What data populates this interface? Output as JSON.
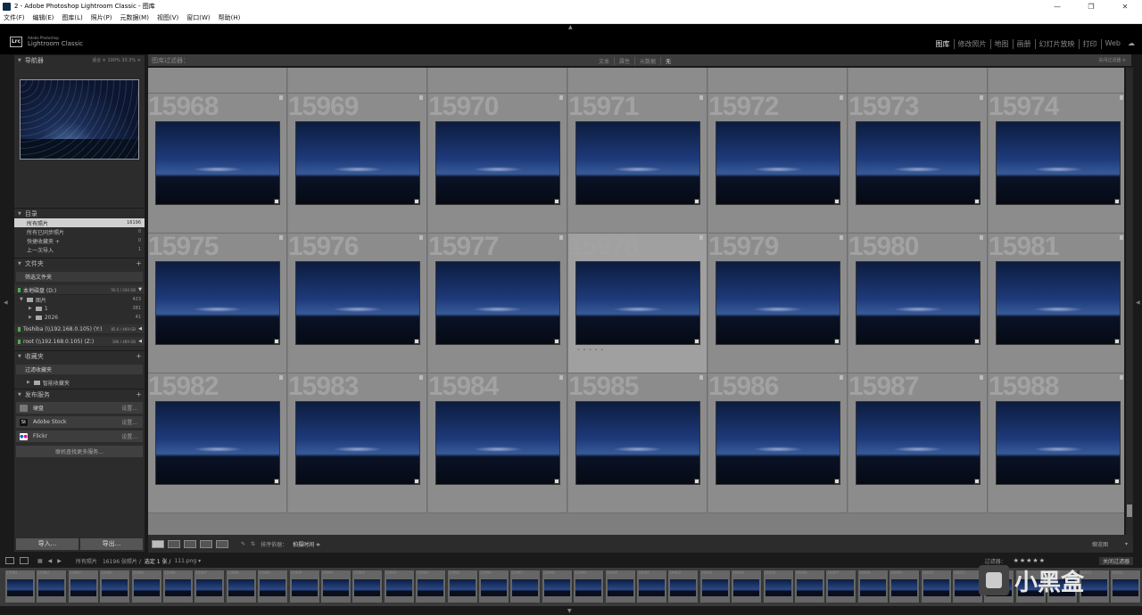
{
  "window": {
    "title": "2 - Adobe Photoshop Lightroom Classic - 图库",
    "controls": [
      "—",
      "❐",
      "✕"
    ]
  },
  "menu": [
    "文件(F)",
    "编辑(E)",
    "图库(L)",
    "照片(P)",
    "元数据(M)",
    "视图(V)",
    "窗口(W)",
    "帮助(H)"
  ],
  "brand": {
    "logo": "Lrc",
    "line1": "Adobe Photoshop",
    "line2": "Lightroom Classic"
  },
  "modules": [
    "图库",
    "修改照片",
    "地图",
    "画册",
    "幻灯片放映",
    "打印",
    "Web"
  ],
  "left": {
    "navigator": {
      "title": "导航器",
      "opts": "适合 ≑  100%  33.3% ≑"
    },
    "catalog": {
      "title": "目录",
      "items": [
        {
          "label": "所有照片",
          "count": "16196"
        },
        {
          "label": "所有已同步照片",
          "count": "0"
        },
        {
          "label": "快捷收藏夹 +",
          "count": "0"
        },
        {
          "label": "上一次导入",
          "count": "1"
        }
      ]
    },
    "folders": {
      "title": "文件夹",
      "filter": "筛选文件夹",
      "vol1": {
        "label": "本地磁盘 (D:)",
        "size": "50.5 / 244 GB"
      },
      "items": [
        {
          "label": "图片",
          "count": "423"
        },
        {
          "label": "1",
          "count": "381"
        },
        {
          "label": "2026",
          "count": "41"
        }
      ],
      "vol2": {
        "label": "Toshiba (\\\\192.168.0.105) (Y:)",
        "size": "85.6 / 469 GB"
      },
      "vol3": {
        "label": "root (\\\\192.168.0.105) (Z:)",
        "size": "186 / 469 GB"
      }
    },
    "collections": {
      "title": "收藏夹",
      "filter": "过滤收藏夹",
      "smart": "智能收藏夹"
    },
    "publish": {
      "title": "发布服务",
      "items": [
        {
          "label": "硬盘",
          "action": "设置..."
        },
        {
          "label": "Adobe Stock",
          "action": "设置..."
        },
        {
          "label": "Flickr",
          "action": "设置..."
        }
      ],
      "more": "联机查找更多服务..."
    },
    "import_label": "导入...",
    "export_label": "导出..."
  },
  "filterbar": {
    "title": "图库过滤器：",
    "options": [
      "文本",
      "属性",
      "元数据",
      "无"
    ],
    "right": "关闭过滤器 ≑"
  },
  "grid": {
    "rows": [
      [
        "",
        "",
        "",
        "",
        "",
        "",
        ""
      ],
      [
        "15968",
        "15969",
        "15970",
        "15971",
        "15972",
        "15973",
        "15974"
      ],
      [
        "15975",
        "15976",
        "15977",
        "15978",
        "15979",
        "15980",
        "15981"
      ],
      [
        "15982",
        "15983",
        "15984",
        "15985",
        "15986",
        "15987",
        "15988"
      ]
    ],
    "selected": "15978",
    "stars": "• • • • •"
  },
  "toolbar": {
    "sort_label": "排序依据：",
    "sort_value": "拍摄时间 ≑",
    "thumb_label": "缩览图"
  },
  "strip": {
    "source": "所有照片",
    "count": "16196 张照片 /",
    "selected": "选定 1 张 /",
    "file": "111.png ▾",
    "filter_label": "过滤器：",
    "stars": "★★★★★",
    "filter_off": "关闭过滤器"
  },
  "filmstrip_labels": [
    "15981",
    "15982",
    "15983",
    "15984",
    "15985",
    "15986",
    "15987",
    "15988",
    "15989",
    "15990",
    "15991",
    "15992",
    "15993",
    "15994",
    "15995",
    "15996",
    "15997",
    "15998",
    "15999",
    "16000",
    "16001",
    "16002",
    "16003",
    "16004",
    "16005",
    "16006",
    "16007",
    "16008",
    "16009",
    "16010",
    "16011",
    "16012",
    "16013",
    "16014",
    "16015",
    "16016"
  ],
  "watermark": "小黑盒"
}
